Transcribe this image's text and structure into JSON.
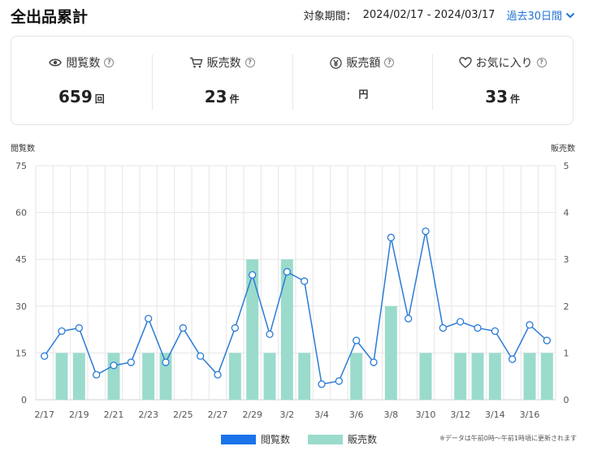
{
  "header": {
    "title": "全出品累計",
    "period_label": "対象期間：",
    "period_range": "2024/02/17 - 2024/03/17",
    "period_select": "過去30日間"
  },
  "stats": [
    {
      "label": "閲覧数",
      "value": "659",
      "unit": "回",
      "icon": "eye-icon"
    },
    {
      "label": "販売数",
      "value": "23",
      "unit": "件",
      "icon": "cart-icon"
    },
    {
      "label": "販売額",
      "value": "",
      "unit": "円",
      "icon": "yen-icon"
    },
    {
      "label": "お気に入り",
      "value": "33",
      "unit": "件",
      "icon": "heart-icon"
    }
  ],
  "help_mark": "?",
  "chart_data": {
    "type": "bar+line",
    "left_axis_title": "閲覧数",
    "right_axis_title": "販売数",
    "left_ticks": [
      0,
      15,
      30,
      45,
      60,
      75
    ],
    "right_ticks": [
      0,
      1,
      2,
      3,
      4,
      5
    ],
    "ylim_left": [
      0,
      75
    ],
    "ylim_right": [
      0,
      5
    ],
    "x_tick_labels": [
      "2/17",
      "2/19",
      "2/21",
      "2/23",
      "2/25",
      "2/27",
      "2/29",
      "3/2",
      "3/4",
      "3/6",
      "3/8",
      "3/10",
      "3/12",
      "3/14",
      "3/16"
    ],
    "dates": [
      "2/17",
      "2/18",
      "2/19",
      "2/20",
      "2/21",
      "2/22",
      "2/23",
      "2/24",
      "2/25",
      "2/26",
      "2/27",
      "2/28",
      "2/29",
      "3/1",
      "3/2",
      "3/3",
      "3/4",
      "3/5",
      "3/6",
      "3/7",
      "3/8",
      "3/9",
      "3/10",
      "3/11",
      "3/12",
      "3/13",
      "3/14",
      "3/15",
      "3/16",
      "3/17"
    ],
    "series": [
      {
        "name": "閲覧数",
        "type": "line",
        "axis": "left",
        "values": [
          14,
          22,
          23,
          8,
          11,
          12,
          26,
          12,
          23,
          14,
          8,
          23,
          40,
          21,
          41,
          38,
          5,
          6,
          19,
          12,
          52,
          26,
          54,
          23,
          25,
          23,
          22,
          13,
          24,
          19
        ]
      },
      {
        "name": "販売数",
        "type": "bar",
        "axis": "right",
        "values": [
          0,
          1,
          1,
          0,
          1,
          0,
          1,
          1,
          0,
          0,
          0,
          1,
          3,
          1,
          3,
          1,
          0,
          0,
          1,
          0,
          2,
          0,
          1,
          0,
          1,
          1,
          1,
          0,
          1,
          1
        ]
      }
    ],
    "colors": {
      "line": "#2b7bd6",
      "bar": "#9adbcc",
      "legend_line": "#1a73e8",
      "grid": "#e6e6e6"
    },
    "legend": [
      "閲覧数",
      "販売数"
    ],
    "legend_position": "bottom",
    "note": "※データは午前0時〜午前1時頃に更新されます"
  }
}
